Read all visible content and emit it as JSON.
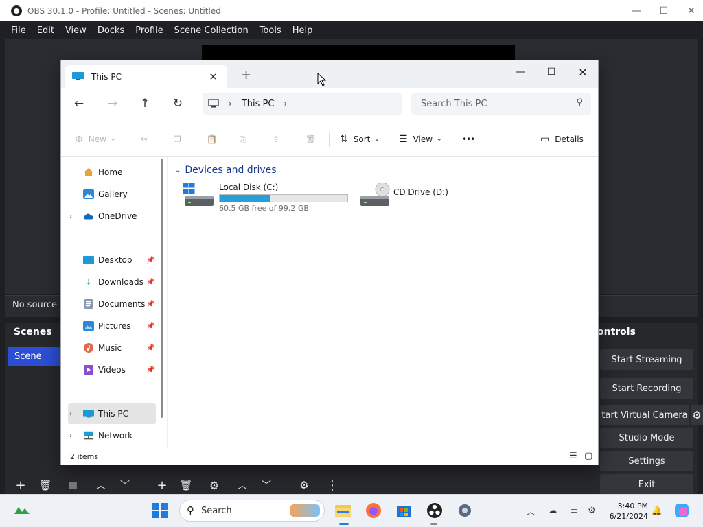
{
  "obs": {
    "title": "OBS 30.1.0 - Profile: Untitled - Scenes: Untitled",
    "menu": [
      "File",
      "Edit",
      "View",
      "Docks",
      "Profile",
      "Scene Collection",
      "Tools",
      "Help"
    ],
    "no_source": "No source s",
    "scenes_title": "Scenes",
    "scene_item": "Scene",
    "controls_title": "ontrols",
    "controls": {
      "start_streaming": "Start Streaming",
      "start_recording": "Start Recording",
      "start_virtual_camera": "tart Virtual Camera",
      "studio_mode": "Studio Mode",
      "settings": "Settings",
      "exit": "Exit"
    }
  },
  "explorer": {
    "tab_title": "This PC",
    "address": {
      "root": "This PC"
    },
    "search_placeholder": "Search This PC",
    "commands": {
      "new": "New",
      "sort": "Sort",
      "view": "View",
      "more": "•••",
      "details": "Details"
    },
    "sidebar": {
      "home": "Home",
      "gallery": "Gallery",
      "onedrive": "OneDrive",
      "desktop": "Desktop",
      "downloads": "Downloads",
      "documents": "Documents",
      "pictures": "Pictures",
      "music": "Music",
      "videos": "Videos",
      "this_pc": "This PC",
      "network": "Network"
    },
    "group_header": "Devices and drives",
    "drives": {
      "c": {
        "name": "Local Disk (C:)",
        "free": "60.5 GB free of 99.2 GB",
        "used_fraction": 0.39
      },
      "d": {
        "name": "CD Drive (D:)"
      }
    },
    "status": "2 items"
  },
  "taskbar": {
    "search_label": "Search",
    "time": "3:40 PM",
    "date": "6/21/2024"
  },
  "colors": {
    "accent_blue": "#26a0da",
    "obs_scene_selected": "#2c4ed4",
    "link_blue": "#1b3a8f"
  }
}
